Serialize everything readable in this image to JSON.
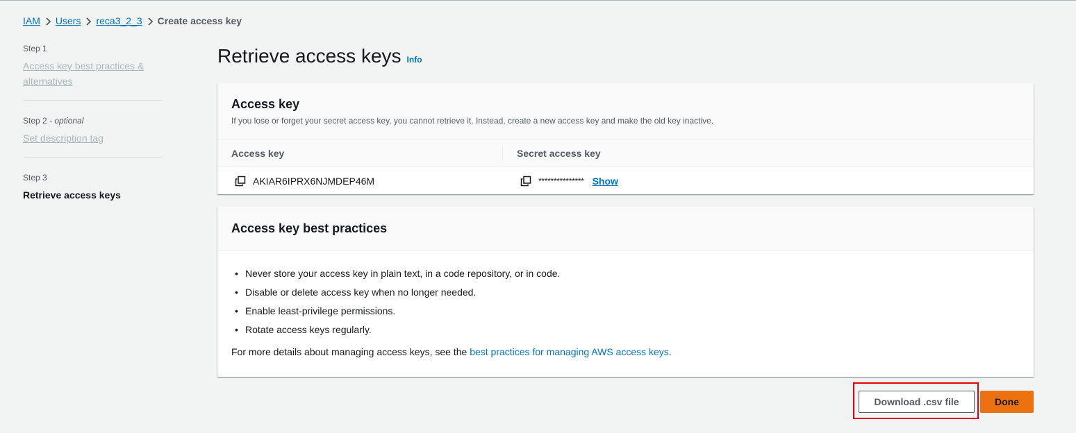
{
  "breadcrumb": {
    "items": [
      "IAM",
      "Users",
      "reca3_2_3"
    ],
    "current": "Create access key"
  },
  "steps": [
    {
      "num": "Step 1",
      "optional": "",
      "label": "Access key best practices & alternatives"
    },
    {
      "num": "Step 2",
      "optional": "- optional",
      "label": "Set description tag"
    },
    {
      "num": "Step 3",
      "optional": "",
      "label": "Retrieve access keys"
    }
  ],
  "page": {
    "title": "Retrieve access keys",
    "info": "Info"
  },
  "access_key_panel": {
    "title": "Access key",
    "description": "If you lose or forget your secret access key, you cannot retrieve it. Instead, create a new access key and make the old key inactive.",
    "columns": [
      "Access key",
      "Secret access key"
    ],
    "access_key_value": "AKIAR6IPRX6NJMDEP46M",
    "secret_masked": "***************",
    "show_label": "Show"
  },
  "best_practices_panel": {
    "title": "Access key best practices",
    "items": [
      "Never store your access key in plain text, in a code repository, or in code.",
      "Disable or delete access key when no longer needed.",
      "Enable least-privilege permissions.",
      "Rotate access keys regularly."
    ],
    "more_prefix": "For more details about managing access keys, see the ",
    "more_link": "best practices for managing AWS access keys",
    "more_suffix": "."
  },
  "actions": {
    "download_label": "Download .csv file",
    "done_label": "Done"
  },
  "colors": {
    "link": "#0073bb",
    "primary_button": "#ec7211",
    "highlight": "#e00010"
  }
}
